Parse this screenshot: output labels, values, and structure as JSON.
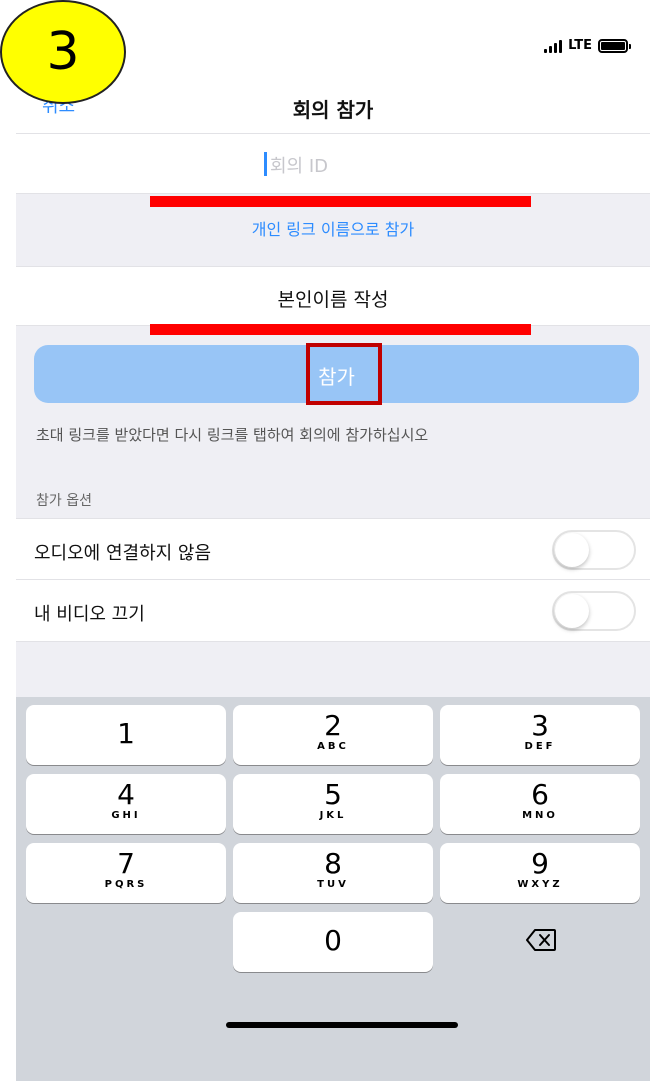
{
  "annotation": {
    "step_number": "3"
  },
  "status_bar": {
    "network": "LTE",
    "signal_icon": "signal-bars-icon",
    "battery_icon": "battery-icon"
  },
  "nav": {
    "back_label": "취소",
    "title": "회의 참가"
  },
  "meeting_id": {
    "placeholder": "회의 ID",
    "value": ""
  },
  "personal_link": {
    "label": "개인 링크 이름으로 참가"
  },
  "name_field": {
    "value": "본인이름 작성"
  },
  "join_button": {
    "label": "참가",
    "color": "#98c5f6"
  },
  "hint_text": "초대 링크를 받았다면 다시 링크를 탭하여 회의에 참가하십시오",
  "options": {
    "section_label": "참가 옵션",
    "items": [
      {
        "label": "오디오에 연결하지 않음",
        "state": "off"
      },
      {
        "label": "내 비디오 끄기",
        "state": "off"
      }
    ]
  },
  "keypad": {
    "keys": [
      {
        "number": "1",
        "letters": ""
      },
      {
        "number": "2",
        "letters": "ABC"
      },
      {
        "number": "3",
        "letters": "DEF"
      },
      {
        "number": "4",
        "letters": "GHI"
      },
      {
        "number": "5",
        "letters": "JKL"
      },
      {
        "number": "6",
        "letters": "MNO"
      },
      {
        "number": "7",
        "letters": "PQRS"
      },
      {
        "number": "8",
        "letters": "TUV"
      },
      {
        "number": "9",
        "letters": "WXYZ"
      },
      {
        "number": "0",
        "letters": ""
      }
    ],
    "delete_icon": "backspace-icon"
  },
  "colors": {
    "accent": "#2d8cff",
    "highlight_red": "#ff0000",
    "badge_yellow": "#ffff00"
  }
}
